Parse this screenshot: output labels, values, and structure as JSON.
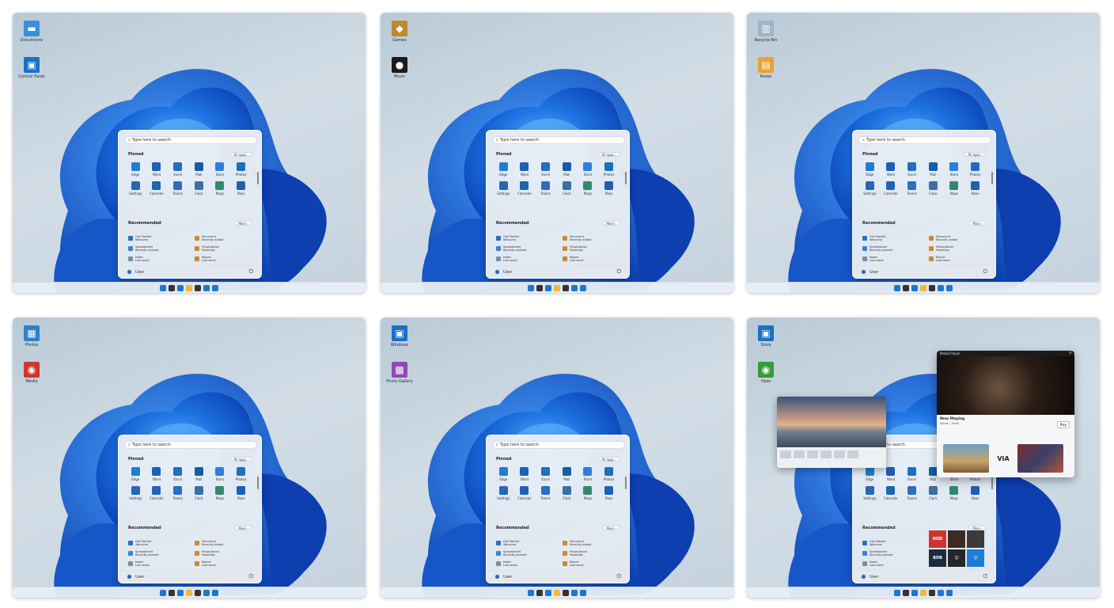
{
  "panels": [
    {
      "desktop_icons": [
        {
          "name": "folder-icon",
          "label": "Documents",
          "color": "#3a8fd8",
          "glyph": "▬"
        },
        {
          "name": "app-icon",
          "label": "Control Panel",
          "color": "#1c6fc5",
          "glyph": "▣"
        }
      ],
      "search_placeholder": "Type here to search",
      "pinned_title": "Pinned",
      "all_apps": "All apps ›",
      "recommended_title": "Recommended",
      "more": "More ›",
      "user": "User",
      "taskbar_colors": [
        "#1f76d2",
        "#333333",
        "#1f76d2",
        "#f3b73a",
        "#333333",
        "#1f76d2",
        "#1f76d2"
      ]
    },
    {
      "desktop_icons": [
        {
          "name": "app-icon",
          "label": "Games",
          "color": "#c08a2c",
          "glyph": "◆"
        },
        {
          "name": "app-icon",
          "label": "Music",
          "color": "#1b1b1b",
          "glyph": "●"
        }
      ],
      "search_placeholder": "Type here to search",
      "pinned_title": "Pinned",
      "all_apps": "All apps ›",
      "recommended_title": "Recommended",
      "more": "More ›",
      "user": "User",
      "taskbar_colors": [
        "#1f76d2",
        "#333333",
        "#1f76d2",
        "#f3b73a",
        "#333333",
        "#1f76d2",
        "#1f76d2"
      ]
    },
    {
      "desktop_icons": [
        {
          "name": "recycle-bin-icon",
          "label": "Recycle Bin",
          "color": "#9fb4c8",
          "glyph": "▥"
        },
        {
          "name": "app-icon",
          "label": "Notes",
          "color": "#e8a23a",
          "glyph": "▤"
        }
      ],
      "search_placeholder": "Type here to search",
      "pinned_title": "Pinned",
      "all_apps": "All apps ›",
      "recommended_title": "Recommended",
      "more": "More ›",
      "user": "User",
      "taskbar_colors": [
        "#1f76d2",
        "#333333",
        "#1f76d2",
        "#f3b73a",
        "#333333",
        "#1f76d2",
        "#1f76d2"
      ]
    },
    {
      "desktop_icons": [
        {
          "name": "app-icon",
          "label": "Photos",
          "color": "#2e7fcc",
          "glyph": "▦"
        },
        {
          "name": "app-icon",
          "label": "Media",
          "color": "#d2372e",
          "glyph": "◉"
        }
      ],
      "search_placeholder": "Type here to search",
      "pinned_title": "Pinned",
      "all_apps": "All apps ›",
      "recommended_title": "Recommended",
      "more": "More ›",
      "user": "User",
      "taskbar_colors": [
        "#1f76d2",
        "#333333",
        "#1f76d2",
        "#f3b73a",
        "#333333",
        "#1f76d2",
        "#1f76d2"
      ]
    },
    {
      "desktop_icons": [
        {
          "name": "app-icon",
          "label": "Windows",
          "color": "#1c6fc5",
          "glyph": "▣"
        },
        {
          "name": "app-icon",
          "label": "Photo Gallery",
          "color": "#8c4db0",
          "glyph": "▩"
        }
      ],
      "search_placeholder": "Type here to search",
      "pinned_title": "Pinned",
      "all_apps": "All apps ›",
      "recommended_title": "Recommended",
      "more": "More ›",
      "user": "User",
      "taskbar_colors": [
        "#1f76d2",
        "#333333",
        "#1f76d2",
        "#f3b73a",
        "#333333",
        "#1f76d2",
        "#1f76d2"
      ]
    },
    {
      "desktop_icons": [
        {
          "name": "app-icon",
          "label": "Store",
          "color": "#1c6fc5",
          "glyph": "▣"
        },
        {
          "name": "app-icon",
          "label": "Xbox",
          "color": "#3a9a3a",
          "glyph": "◉"
        }
      ],
      "search_placeholder": "Type here to search",
      "pinned_title": "Pinned",
      "all_apps": "All apps ›",
      "recommended_title": "Recommended",
      "more": "More ›",
      "user": "User",
      "taskbar_colors": [
        "#1f76d2",
        "#333333",
        "#1f76d2",
        "#f3b73a",
        "#333333",
        "#1f76d2",
        "#1f76d2"
      ],
      "media": {
        "window_title": "Media Player",
        "title": "Now Playing",
        "subtitle": "Album · Artist",
        "button": "Play",
        "mid_label": "VIA"
      },
      "tiles": [
        {
          "label": "HOD",
          "color": "#d0332b"
        },
        {
          "label": "",
          "color": "#3d2a20"
        },
        {
          "label": "",
          "color": "#3b3b3b"
        },
        {
          "label": "BOB",
          "color": "#1f2a3b"
        },
        {
          "label": "☺",
          "color": "#262626"
        },
        {
          "label": "☺",
          "color": "#1c7ed6"
        }
      ]
    }
  ],
  "apps": [
    {
      "label": "Edge",
      "color": "#1b7fd4"
    },
    {
      "label": "Word",
      "color": "#1f5fb4"
    },
    {
      "label": "Excel",
      "color": "#1f6fc5"
    },
    {
      "label": "Mail",
      "color": "#145ea8"
    },
    {
      "label": "Store",
      "color": "#2d7fdb"
    },
    {
      "label": "Photos",
      "color": "#1b6fc0"
    },
    {
      "label": "Settings",
      "color": "#2567b5"
    },
    {
      "label": "Calendar",
      "color": "#1e64b2"
    },
    {
      "label": "Teams",
      "color": "#2b6ec2"
    },
    {
      "label": "Clock",
      "color": "#3a6fa8"
    },
    {
      "label": "Maps",
      "color": "#2f8a6a"
    },
    {
      "label": "Xbox",
      "color": "#1f5fb4"
    }
  ],
  "recommended": [
    {
      "title": "Get Started",
      "sub": "Welcome",
      "color": "#2d6fc0"
    },
    {
      "title": "Document",
      "sub": "Recently added",
      "color": "#c98a2a"
    },
    {
      "title": "Spreadsheet",
      "sub": "Recently opened",
      "color": "#3a84c9"
    },
    {
      "title": "Presentation",
      "sub": "Yesterday",
      "color": "#d08a2a"
    },
    {
      "title": "Notes",
      "sub": "Last week",
      "color": "#7b8fa3"
    },
    {
      "title": "Report",
      "sub": "Last week",
      "color": "#c98a2a"
    }
  ]
}
